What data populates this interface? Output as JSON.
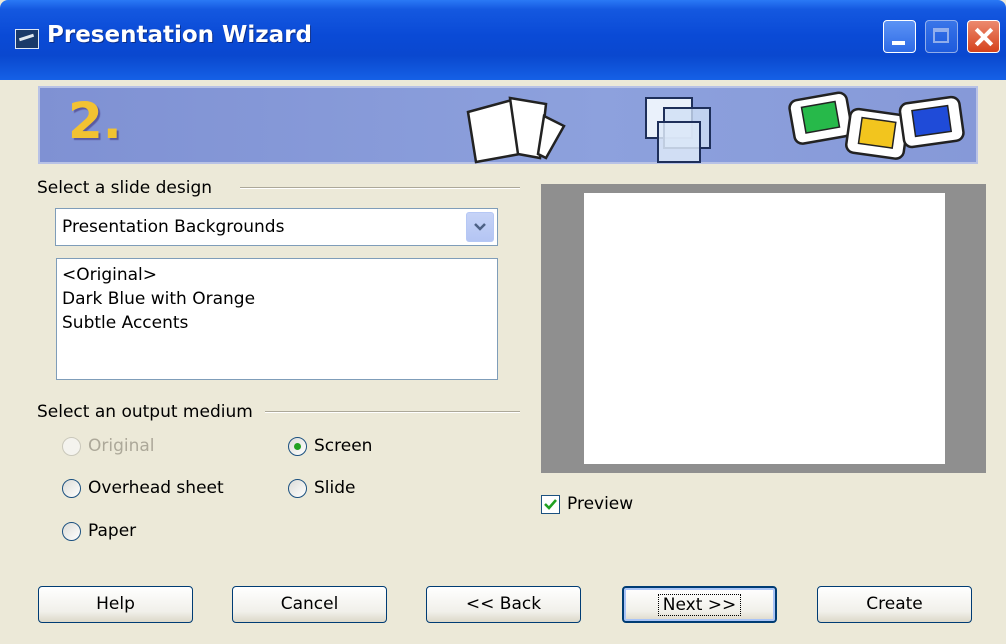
{
  "window": {
    "title": "Presentation Wizard",
    "step": "2."
  },
  "design_section": {
    "label": "Select a slide design",
    "dropdown_value": "Presentation Backgrounds",
    "list_items": [
      "<Original>",
      "Dark Blue with Orange",
      "Subtle Accents"
    ]
  },
  "output_section": {
    "label": "Select an output medium",
    "options": [
      {
        "label": "Original",
        "checked": false,
        "disabled": true
      },
      {
        "label": "Screen",
        "checked": true,
        "disabled": false
      },
      {
        "label": "Overhead sheet",
        "checked": false,
        "disabled": false
      },
      {
        "label": "Slide",
        "checked": false,
        "disabled": false
      },
      {
        "label": "Paper",
        "checked": false,
        "disabled": false
      }
    ]
  },
  "preview": {
    "checkbox_label": "Preview",
    "checked": true
  },
  "buttons": {
    "help": "Help",
    "cancel": "Cancel",
    "back": "<< Back",
    "next": "Next >>",
    "create": "Create"
  },
  "colors": {
    "titlebar": "#0a48cf",
    "banner": "#8699d8",
    "step_number": "#f2c232",
    "dialog": "#ece9d8"
  }
}
